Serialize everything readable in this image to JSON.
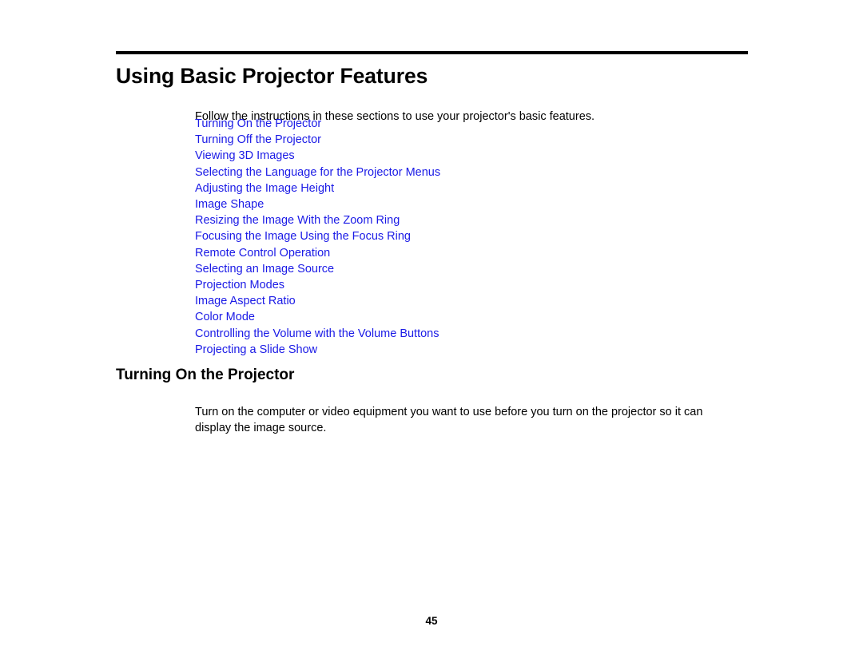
{
  "document": {
    "title": "Using Basic Projector Features",
    "intro": "Follow the instructions in these sections to use your projector's basic features.",
    "toc": [
      {
        "label": "Turning On the Projector"
      },
      {
        "label": "Turning Off the Projector"
      },
      {
        "label": "Viewing 3D Images"
      },
      {
        "label": "Selecting the Language for the Projector Menus"
      },
      {
        "label": "Adjusting the Image Height"
      },
      {
        "label": "Image Shape"
      },
      {
        "label": "Resizing the Image With the Zoom Ring"
      },
      {
        "label": "Focusing the Image Using the Focus Ring"
      },
      {
        "label": "Remote Control Operation"
      },
      {
        "label": "Selecting an Image Source"
      },
      {
        "label": "Projection Modes"
      },
      {
        "label": "Image Aspect Ratio"
      },
      {
        "label": "Color Mode"
      },
      {
        "label": "Controlling the Volume with the Volume Buttons"
      },
      {
        "label": "Projecting a Slide Show"
      }
    ],
    "section": {
      "heading": "Turning On the Projector",
      "paragraph": "Turn on the computer or video equipment you want to use before you turn on the projector so it can display the image source."
    },
    "page_number": "45",
    "colors": {
      "link": "#1a1ae6",
      "text": "#000000",
      "rule": "#000000"
    }
  }
}
